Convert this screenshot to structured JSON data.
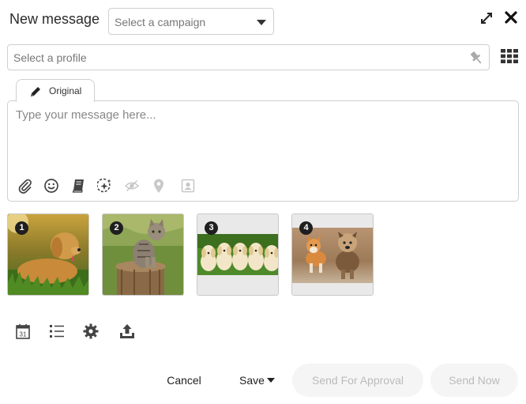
{
  "header": {
    "title": "New message",
    "campaign_placeholder": "Select a campaign",
    "icons": [
      "expand-icon",
      "close-icon"
    ]
  },
  "profile": {
    "placeholder": "Select a profile",
    "icons": [
      "pin-icon",
      "grid-icon"
    ]
  },
  "composer": {
    "tab_label": "Original",
    "tab_icon": "pencil-icon",
    "placeholder": "Type your message here...",
    "toolbar_icons": [
      "paperclip-icon",
      "emoji-icon",
      "library-icon",
      "ai-sparkle-icon",
      "preview-hidden-icon",
      "location-pin-icon",
      "contact-card-icon"
    ]
  },
  "media": [
    {
      "index": "1",
      "subject": "golden retriever on grass"
    },
    {
      "index": "2",
      "subject": "tabby cat on tree stump"
    },
    {
      "index": "3",
      "subject": "row of golden puppies"
    },
    {
      "index": "4",
      "subject": "corgi and yorkie running"
    }
  ],
  "actions": {
    "icons": [
      "calendar-icon",
      "list-icon",
      "settings-icon",
      "upload-icon"
    ],
    "calendar_day": "31"
  },
  "footer": {
    "cancel_label": "Cancel",
    "save_label": "Save",
    "approval_label": "Send For Approval",
    "send_label": "Send Now"
  },
  "colors": {
    "border": "#cfcfcf",
    "disabled_bg": "#f5f5f5",
    "disabled_text": "#bbbbbb",
    "badge_bg": "#1f1f1f"
  }
}
